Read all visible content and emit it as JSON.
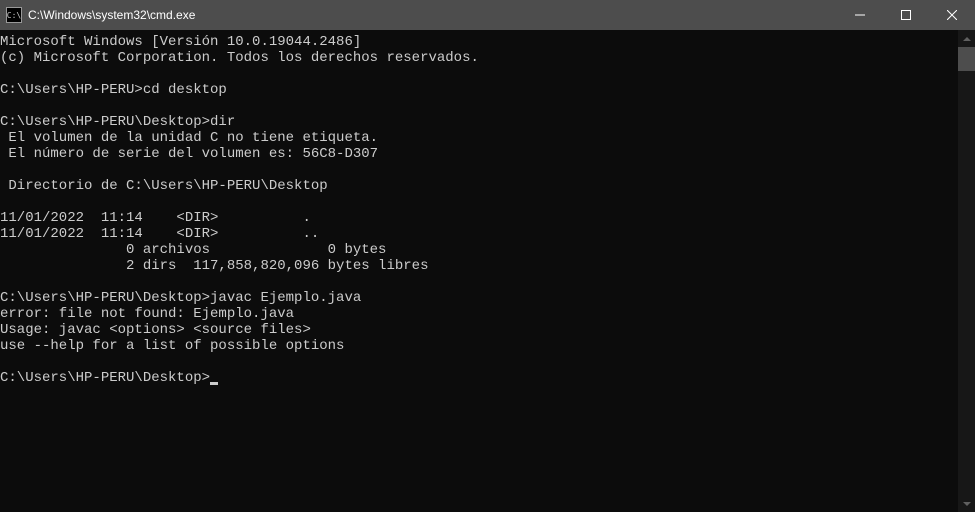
{
  "window": {
    "title": "C:\\Windows\\system32\\cmd.exe",
    "icon_label": "C:\\"
  },
  "terminal": {
    "lines": [
      "Microsoft Windows [Versión 10.0.19044.2486]",
      "(c) Microsoft Corporation. Todos los derechos reservados.",
      "",
      "C:\\Users\\HP-PERU>cd desktop",
      "",
      "C:\\Users\\HP-PERU\\Desktop>dir",
      " El volumen de la unidad C no tiene etiqueta.",
      " El número de serie del volumen es: 56C8-D307",
      "",
      " Directorio de C:\\Users\\HP-PERU\\Desktop",
      "",
      "11/01/2022  11:14    <DIR>          .",
      "11/01/2022  11:14    <DIR>          ..",
      "               0 archivos              0 bytes",
      "               2 dirs  117,858,820,096 bytes libres",
      "",
      "C:\\Users\\HP-PERU\\Desktop>javac Ejemplo.java",
      "error: file not found: Ejemplo.java",
      "Usage: javac <options> <source files>",
      "use --help for a list of possible options",
      "",
      "C:\\Users\\HP-PERU\\Desktop>"
    ],
    "current_prompt": "C:\\Users\\HP-PERU\\Desktop>"
  }
}
